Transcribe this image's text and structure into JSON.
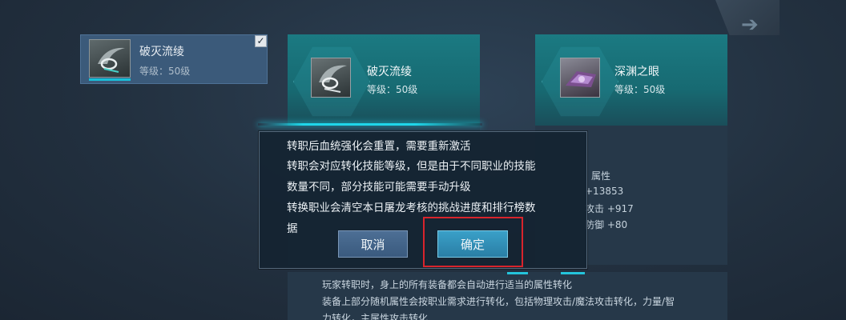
{
  "selected_item": {
    "name": "破灭流绫",
    "level": "等级：50级",
    "checked": true
  },
  "current_item": {
    "name": "破灭流绫",
    "level": "等级：50级"
  },
  "target_item": {
    "name": "深渊之眼",
    "level": "等级：50级",
    "stats": [
      "属性",
      "+13853",
      "攻击 +917",
      "防御 +80"
    ]
  },
  "description": {
    "lines": [
      "玩家转职时，身上的所有装备都会自动进行适当的属性转化",
      "装备上部分随机属性会按职业需求进行转化，包括物理攻击/魔法攻击转化，力量/智",
      "力转化，主属性攻击转化"
    ]
  },
  "dialog": {
    "lines": [
      "转职后血统强化会重置，需要重新激活",
      "转职会对应转化技能等级，但是由于不同职业的技能",
      "数量不同，部分技能可能需要手动升级",
      "转换职业会清空本日屠龙考核的挑战进度和排行榜数",
      "据"
    ],
    "cancel_label": "取消",
    "confirm_label": "确定"
  },
  "icons": {
    "nav": "arrow-right-icon",
    "check": "checkmark-icon",
    "item_current": "scythe-weapon-icon",
    "item_target": "abyss-eye-weapon-icon"
  },
  "colors": {
    "accent": "#1fd6ea",
    "highlight": "#d8242c",
    "confirm_button": "#2a7ea5",
    "cancel_button": "#3a5a7e"
  }
}
